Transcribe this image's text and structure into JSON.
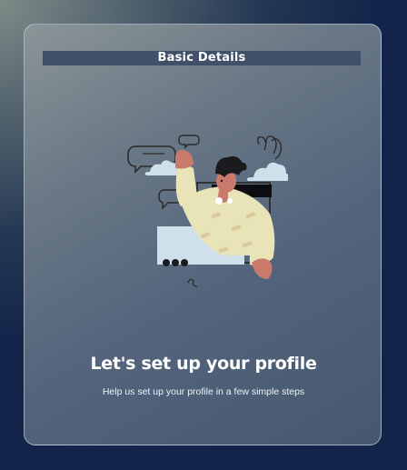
{
  "header": {
    "title": "Basic Details"
  },
  "onboarding": {
    "heading": "Let's set up your profile",
    "subheading": "Help us set up your profile in a few simple steps",
    "illustration": "person-waving-from-window-illustration"
  },
  "colors": {
    "background": "#13264a",
    "card": "#5e6e80",
    "title_bar": "#3f5068",
    "accent_skin": "#c97a6a",
    "accent_shirt": "#e9e3b8"
  }
}
